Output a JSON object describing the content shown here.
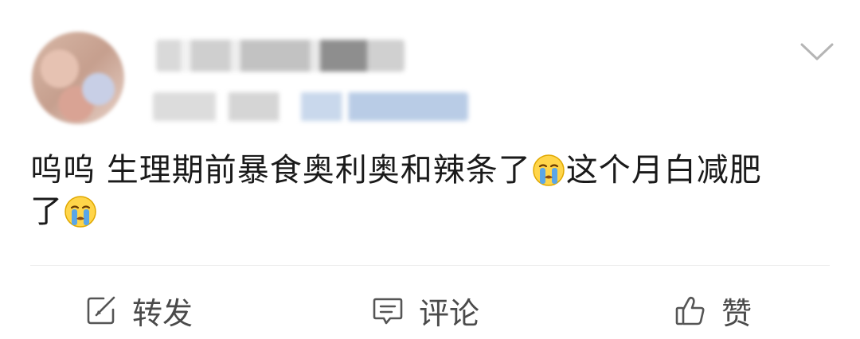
{
  "post": {
    "content_line1": "呜呜 生理期前暴食奥利奥和辣条了",
    "content_mid": "这个月白减肥",
    "content_line2": "了",
    "emoji": "crying-face-emoji"
  },
  "actions": {
    "repost_label": "转发",
    "comment_label": "评论",
    "like_label": "赞"
  },
  "colors": {
    "text": "#1a1a1a",
    "action_text": "#4a4a4a",
    "icon": "#555555",
    "divider": "#ececec",
    "emoji_face": "#ffd54a",
    "emoji_tears": "#5aa6e8"
  }
}
